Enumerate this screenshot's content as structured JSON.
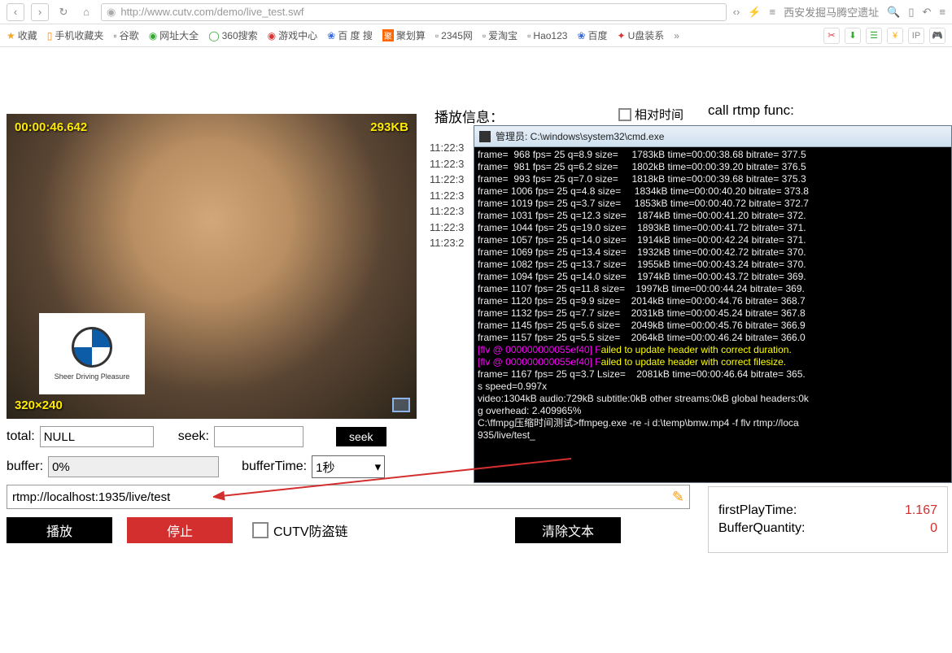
{
  "browser": {
    "url": "http://www.cutv.com/demo/live_test.swf",
    "search_placeholder": "西安发掘马腾空遗址"
  },
  "bookmarks": [
    "收藏",
    "手机收藏夹",
    "谷歌",
    "网址大全",
    "360搜索",
    "游戏中心",
    "百 度 搜",
    "聚划算",
    "2345网",
    "爱淘宝",
    "Hao123",
    "百度",
    "U盘装系"
  ],
  "video": {
    "time": "00:00:46.642",
    "kb": "293KB",
    "res": "320×240",
    "logo_caption": "Sheer Driving Pleasure"
  },
  "controls": {
    "total_label": "total:",
    "total_value": "NULL",
    "seek_label": "seek:",
    "seek_value": "",
    "seek_btn": "seek",
    "buffer_label": "buffer:",
    "buffer_value": "0%",
    "bufferTime_label": "bufferTime:",
    "bufferTime_value": "1秒",
    "url_value": "rtmp://localhost:1935/live/test",
    "play_btn": "播放",
    "stop_btn": "停止",
    "chain_label": "CUTV防盗链",
    "clear_btn": "清除文本"
  },
  "right": {
    "info_label": "播放信息：",
    "rel_label": "相对时间",
    "call_label": "call rtmp func:",
    "side_times": [
      "11:22:3",
      "11:22:3",
      "11:22:3",
      "11:22:3",
      "11:22:3",
      "11:22:3",
      "11:23:2"
    ]
  },
  "cmd": {
    "title": "管理员: C:\\windows\\system32\\cmd.exe",
    "lines": [
      {
        "c": "wht",
        "t": "frame=  968 fps= 25 q=8.9 size=     1783kB time=00:00:38.68 bitrate= 377.5"
      },
      {
        "c": "wht",
        "t": "frame=  981 fps= 25 q=6.2 size=     1802kB time=00:00:39.20 bitrate= 376.5"
      },
      {
        "c": "wht",
        "t": "frame=  993 fps= 25 q=7.0 size=     1818kB time=00:00:39.68 bitrate= 375.3"
      },
      {
        "c": "wht",
        "t": "frame= 1006 fps= 25 q=4.8 size=     1834kB time=00:00:40.20 bitrate= 373.8"
      },
      {
        "c": "wht",
        "t": "frame= 1019 fps= 25 q=3.7 size=     1853kB time=00:00:40.72 bitrate= 372.7"
      },
      {
        "c": "wht",
        "t": "frame= 1031 fps= 25 q=12.3 size=    1874kB time=00:00:41.20 bitrate= 372."
      },
      {
        "c": "wht",
        "t": "frame= 1044 fps= 25 q=19.0 size=    1893kB time=00:00:41.72 bitrate= 371."
      },
      {
        "c": "wht",
        "t": "frame= 1057 fps= 25 q=14.0 size=    1914kB time=00:00:42.24 bitrate= 371."
      },
      {
        "c": "wht",
        "t": "frame= 1069 fps= 25 q=13.4 size=    1932kB time=00:00:42.72 bitrate= 370."
      },
      {
        "c": "wht",
        "t": "frame= 1082 fps= 25 q=13.7 size=    1955kB time=00:00:43.24 bitrate= 370."
      },
      {
        "c": "wht",
        "t": "frame= 1094 fps= 25 q=14.0 size=    1974kB time=00:00:43.72 bitrate= 369."
      },
      {
        "c": "wht",
        "t": "frame= 1107 fps= 25 q=11.8 size=    1997kB time=00:00:44.24 bitrate= 369."
      },
      {
        "c": "wht",
        "t": "frame= 1120 fps= 25 q=9.9 size=    2014kB time=00:00:44.76 bitrate= 368.7"
      },
      {
        "c": "wht",
        "t": "frame= 1132 fps= 25 q=7.7 size=    2031kB time=00:00:45.24 bitrate= 367.8"
      },
      {
        "c": "wht",
        "t": "frame= 1145 fps= 25 q=5.6 size=    2049kB time=00:00:45.76 bitrate= 366.9"
      },
      {
        "c": "wht",
        "t": "frame= 1157 fps= 25 q=5.5 size=    2064kB time=00:00:46.24 bitrate= 366.0"
      },
      {
        "c": "err",
        "t": "[flv @ 000000000055ef40] Failed to update header with correct duration."
      },
      {
        "c": "err",
        "t": "[flv @ 000000000055ef40] Failed to update header with correct filesize."
      },
      {
        "c": "wht",
        "t": "frame= 1167 fps= 25 q=3.7 Lsize=    2081kB time=00:00:46.64 bitrate= 365."
      },
      {
        "c": "wht",
        "t": "s speed=0.997x"
      },
      {
        "c": "wht",
        "t": "video:1304kB audio:729kB subtitle:0kB other streams:0kB global headers:0k"
      },
      {
        "c": "wht",
        "t": "g overhead: 2.409965%"
      },
      {
        "c": "wht",
        "t": ""
      },
      {
        "c": "wht",
        "t": "C:\\ffmpg压缩时间测试>ffmpeg.exe -re -i d:\\temp\\bmw.mp4 -f flv rtmp://loca"
      },
      {
        "c": "wht",
        "t": "935/live/test_"
      }
    ]
  },
  "stats": {
    "firstPlayTime_label": "firstPlayTime:",
    "firstPlayTime_value": "1.167",
    "bufferQuantity_label": "BufferQuantity:",
    "bufferQuantity_value": "0"
  }
}
